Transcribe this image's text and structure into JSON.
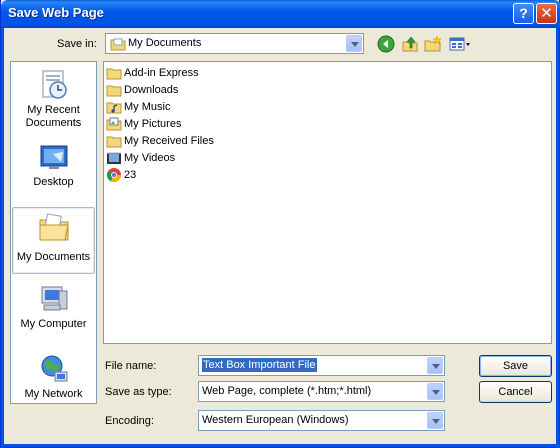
{
  "window": {
    "title": "Save Web Page",
    "help_glyph": "?",
    "close_glyph": "✕"
  },
  "save_in": {
    "label": "Save in:",
    "value": "My Documents"
  },
  "places": [
    {
      "label": "My Recent Documents",
      "line1": "My Recent",
      "line2": "Documents",
      "icon": "recent-documents-icon"
    },
    {
      "label": "Desktop",
      "icon": "desktop-icon"
    },
    {
      "label": "My Documents",
      "icon": "my-documents-icon",
      "selected": true
    },
    {
      "label": "My Computer",
      "icon": "my-computer-icon"
    },
    {
      "label": "My Network",
      "icon": "my-network-icon"
    }
  ],
  "files": [
    {
      "name": "Add-in Express",
      "icon": "folder-icon"
    },
    {
      "name": "Downloads",
      "icon": "folder-icon"
    },
    {
      "name": "My Music",
      "icon": "music-folder-icon"
    },
    {
      "name": "My Pictures",
      "icon": "pictures-folder-icon"
    },
    {
      "name": "My Received Files",
      "icon": "folder-icon"
    },
    {
      "name": "My Videos",
      "icon": "videos-folder-icon"
    },
    {
      "name": "23",
      "icon": "chrome-icon"
    }
  ],
  "form": {
    "file_name_label": "File name:",
    "file_name_value": "Text Box Important File",
    "save_as_type_label": "Save as type:",
    "save_as_type_value": "Web Page, complete (*.htm;*.html)",
    "encoding_label": "Encoding:",
    "encoding_value": "Western European (Windows)"
  },
  "buttons": {
    "save": "Save",
    "cancel": "Cancel"
  },
  "colors": {
    "title_bar": "#0054e3",
    "selection": "#316ac5",
    "dialog_bg": "#ece9d8"
  }
}
